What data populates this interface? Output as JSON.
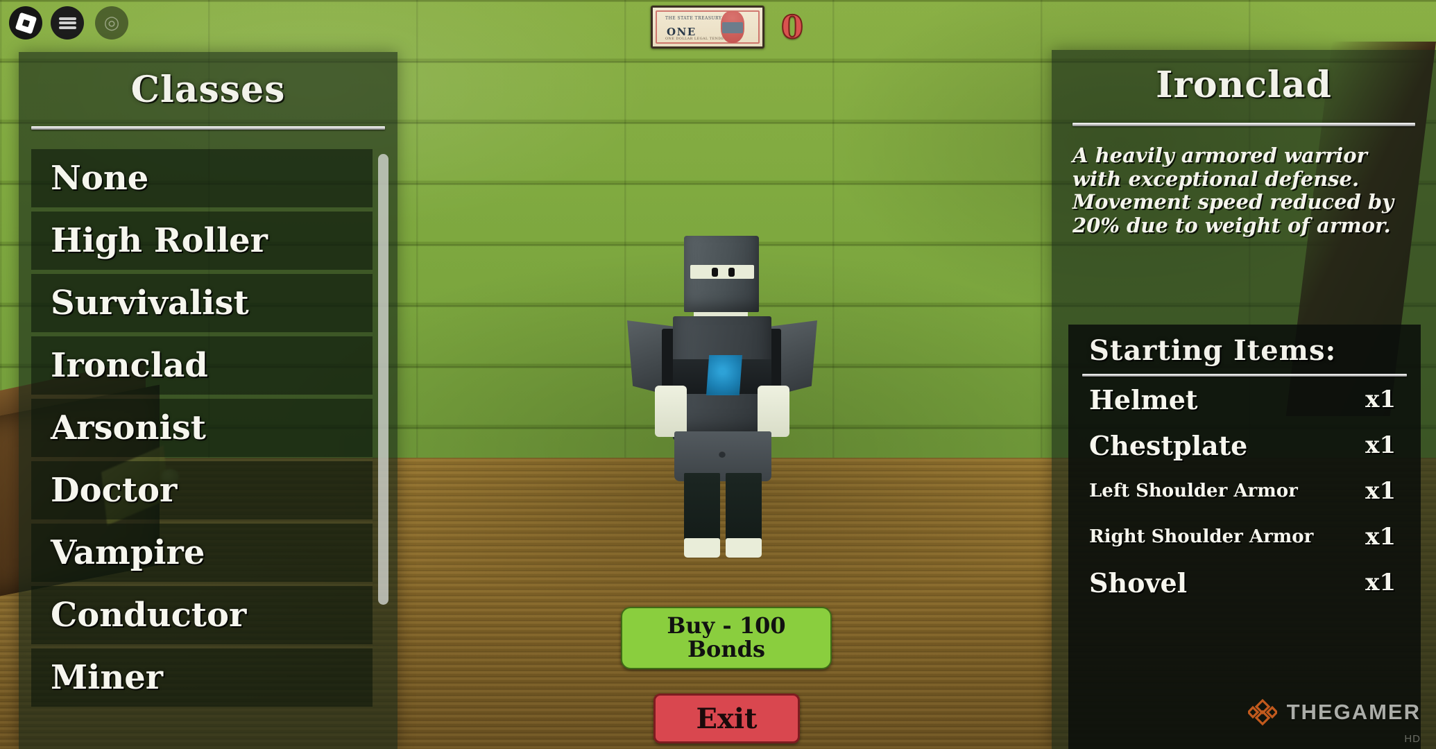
{
  "game_hud": {
    "roblox_logo_label": "Roblox",
    "menu_label": "Menu",
    "backpack_label": "Backpack",
    "backpack_glyph": "◎",
    "currency": {
      "bill_value": "ONE",
      "bill_top_text": "THE STATE TREASURY NOTE",
      "bill_bottom_text": "ONE DOLLAR LEGAL TENDER",
      "amount": "0"
    }
  },
  "classes_panel": {
    "title": "Classes",
    "items": [
      {
        "label": "None"
      },
      {
        "label": "High Roller"
      },
      {
        "label": "Survivalist"
      },
      {
        "label": "Ironclad"
      },
      {
        "label": "Arsonist"
      },
      {
        "label": "Doctor"
      },
      {
        "label": "Vampire"
      },
      {
        "label": "Conductor"
      },
      {
        "label": "Miner"
      }
    ],
    "selected": "Ironclad"
  },
  "detail_panel": {
    "title": "Ironclad",
    "description": "A heavily armored warrior with exceptional defense. Movement speed reduced by 20% due to weight of armor.",
    "starting_items_title": "Starting Items:",
    "starting_items": [
      {
        "name": "Helmet",
        "qty": "x1",
        "size": "lg"
      },
      {
        "name": "Chestplate",
        "qty": "x1",
        "size": "lg"
      },
      {
        "name": "Left Shoulder Armor",
        "qty": "x1",
        "size": "sm"
      },
      {
        "name": "Right Shoulder Armor",
        "qty": "x1",
        "size": "sm"
      },
      {
        "name": "Shovel",
        "qty": "x1",
        "size": "lg"
      }
    ]
  },
  "actions": {
    "buy_label": "Buy - 100\nBonds",
    "buy_price": "100",
    "buy_currency": "Bonds",
    "exit_label": "Exit"
  },
  "watermark": {
    "text": "THEGAMER",
    "sub": "HD"
  },
  "colors": {
    "buy_green": "#8ace3e",
    "exit_red": "#d9474f",
    "panel_bg": "rgba(24,40,24,0.62)",
    "wall_green": "#7ca73a",
    "floor_brown": "#8e6e2c",
    "text_white": "#f6f6ee",
    "currency_red": "#d9534f"
  }
}
